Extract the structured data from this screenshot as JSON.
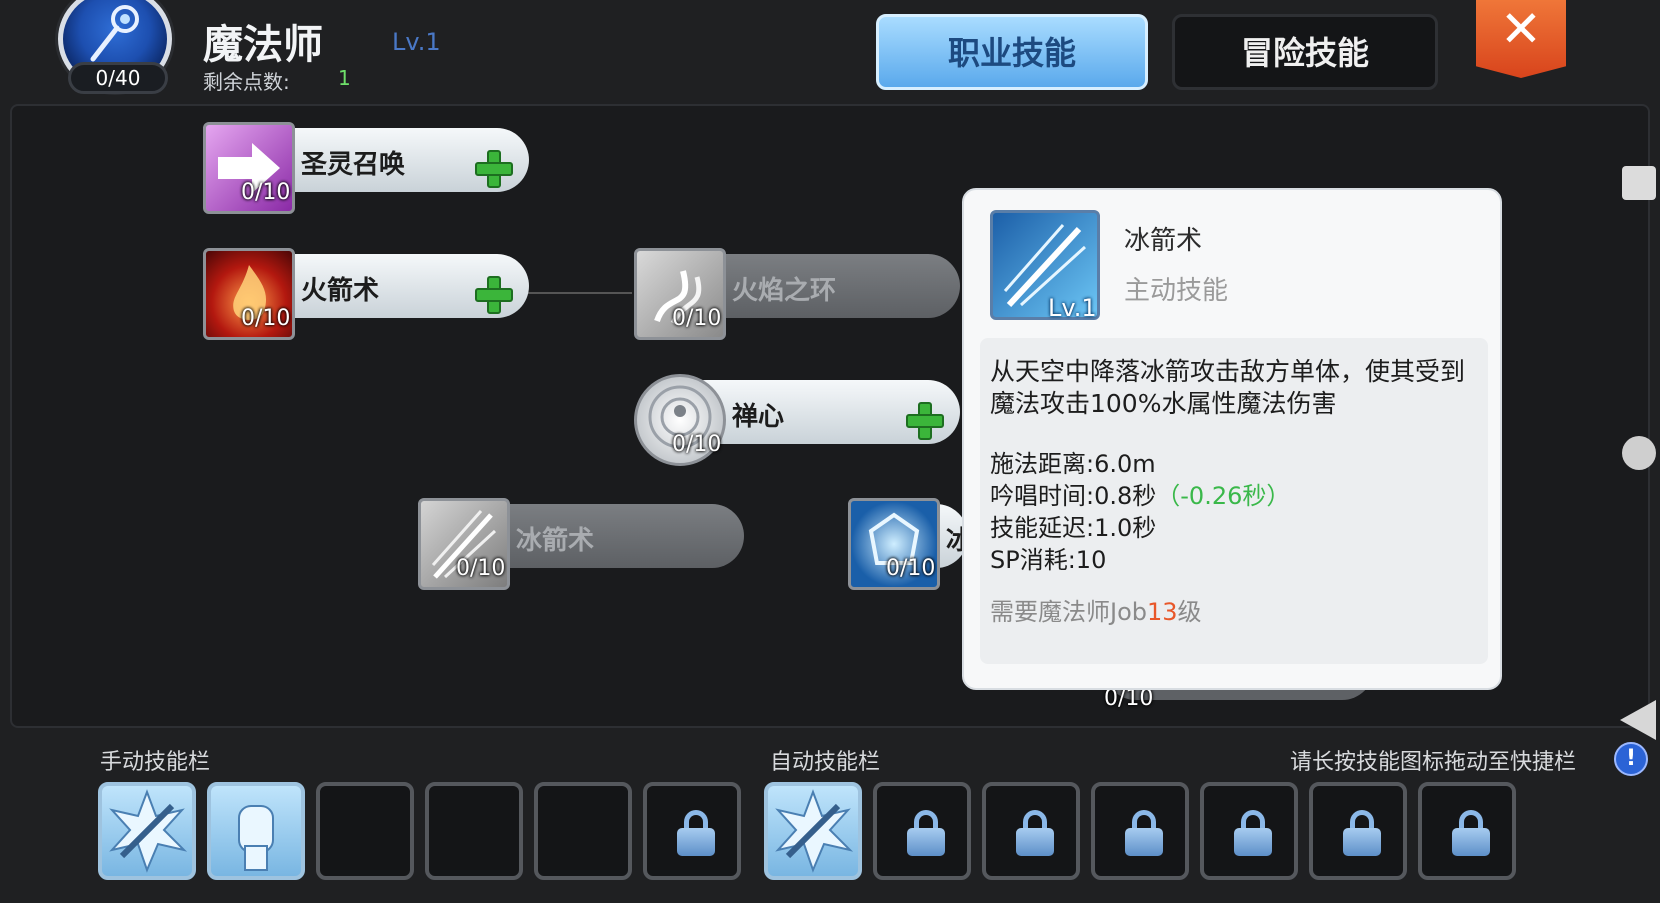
{
  "header": {
    "class_name": "魔法师",
    "class_level": "Lv.1",
    "medal_points": "0/40",
    "points_label": "剩余点数:",
    "points_value": "1",
    "tab_job": "职业技能",
    "tab_adventure": "冒险技能",
    "close_label": "✕"
  },
  "skills": [
    {
      "name": "圣灵召唤",
      "count": "0/10",
      "icon": "holy-arrow-icon",
      "color": "#a13ab8"
    },
    {
      "name": "火箭术",
      "count": "0/10",
      "icon": "fire-icon",
      "color": "#c02418"
    },
    {
      "name": "火焰之环",
      "count": "0/10",
      "icon": "flame-ring-icon",
      "color": "#9a9a9a"
    },
    {
      "name": "禅心",
      "count": "0/10",
      "icon": "meditation-icon",
      "color": "#d5d8db"
    },
    {
      "name": "冰箭术",
      "count": "0/10",
      "icon": "ice-arrow-icon",
      "color": "#9a9a9a"
    },
    {
      "name": "冰",
      "count": "0/10",
      "icon": "ice-crystal-icon",
      "color": "#1f6cb8"
    },
    {
      "name": "",
      "count": "0/10",
      "icon": "hidden-skill-icon",
      "color": "#888888"
    }
  ],
  "tooltip": {
    "name": "冰箭术",
    "level": "Lv.1",
    "type": "主动技能",
    "description": "从天空中降落冰箭攻击敌方单体，使其受到魔法攻击100%水属性魔法伤害",
    "cast_range_label": "施法距离:",
    "cast_range": "6.0m",
    "chant_label": "吟唱时间:",
    "chant_time": "0.8秒",
    "chant_bonus": "（-0.26秒）",
    "delay_label": "技能延迟:",
    "delay": "1.0秒",
    "sp_label": "SP消耗:",
    "sp": "10",
    "req_prefix": "需要魔法师Job",
    "req_level": "13",
    "req_suffix": "级"
  },
  "bottom": {
    "manual_label": "手动技能栏",
    "auto_label": "自动技能栏",
    "hint": "请长按技能图标拖动至快捷栏",
    "info": "!"
  }
}
